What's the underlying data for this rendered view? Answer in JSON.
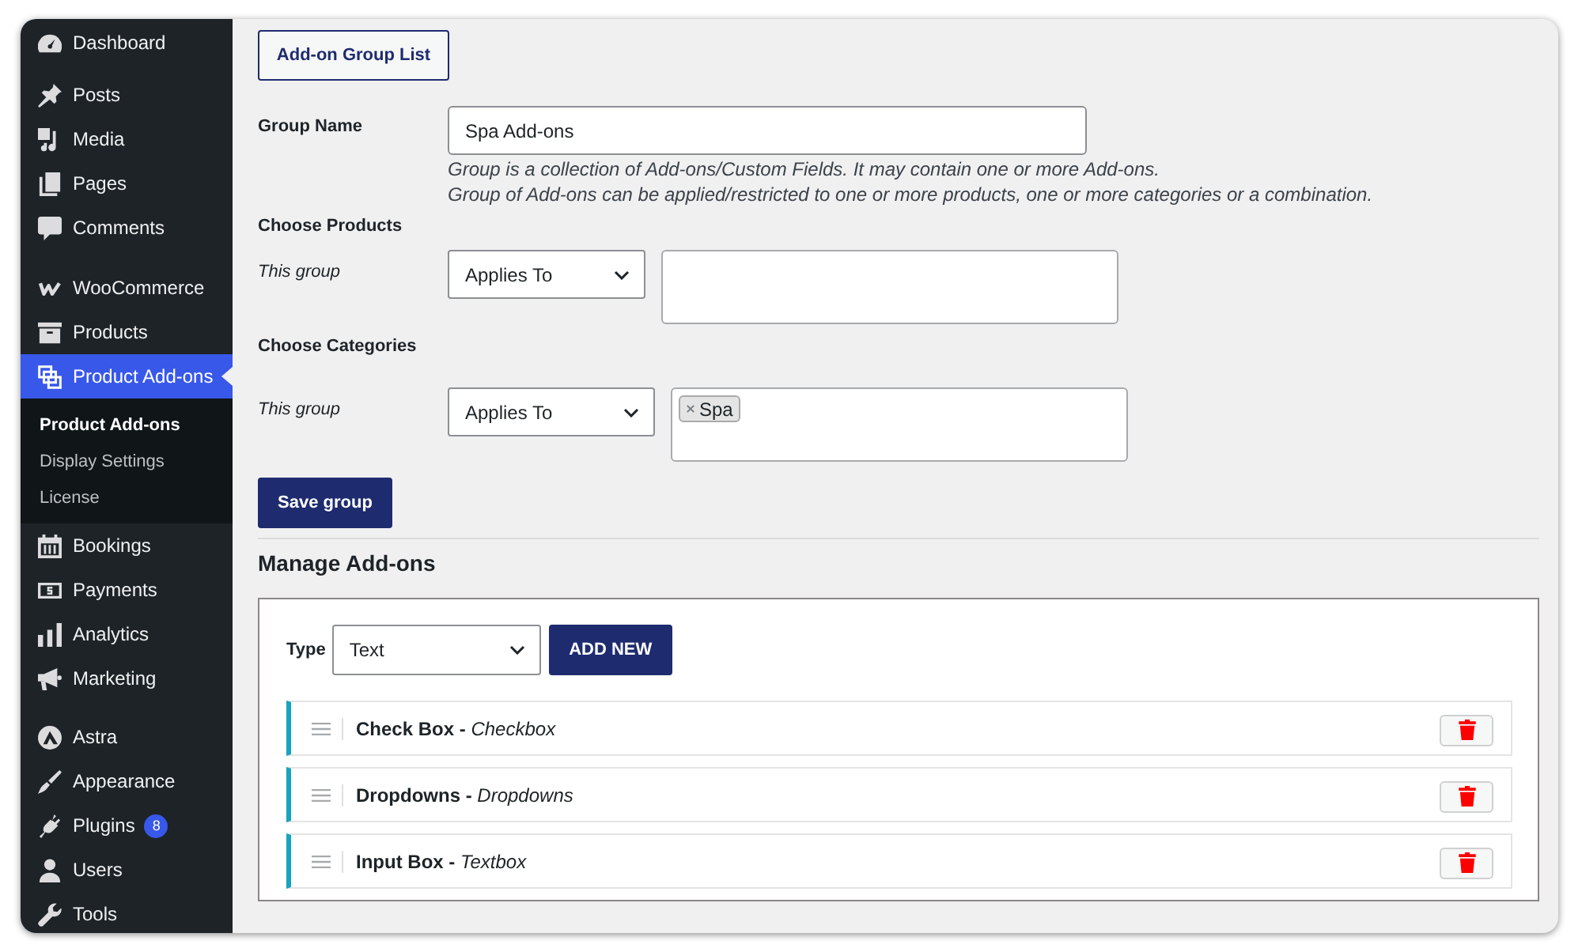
{
  "sidebar": {
    "groups": [
      {
        "items": [
          {
            "label": "Dashboard",
            "selected": false
          }
        ]
      },
      {
        "items": [
          {
            "label": "Posts",
            "selected": false
          },
          {
            "label": "Media",
            "selected": false
          },
          {
            "label": "Pages",
            "selected": false
          },
          {
            "label": "Comments",
            "selected": false
          }
        ]
      },
      {
        "items": [
          {
            "label": "WooCommerce",
            "selected": false
          },
          {
            "label": "Products",
            "selected": false
          },
          {
            "label": "Product Add-ons",
            "selected": true,
            "children": [
              {
                "label": "Product Add-ons",
                "selected": true
              },
              {
                "label": "Display Settings",
                "selected": false
              },
              {
                "label": "License",
                "selected": false
              }
            ]
          },
          {
            "label": "Bookings",
            "selected": false
          },
          {
            "label": "Payments",
            "selected": false
          },
          {
            "label": "Analytics",
            "selected": false
          },
          {
            "label": "Marketing",
            "selected": false
          }
        ]
      },
      {
        "items": [
          {
            "label": "Astra",
            "selected": false
          },
          {
            "label": "Appearance",
            "selected": false
          },
          {
            "label": "Plugins",
            "selected": false,
            "badge": "8"
          },
          {
            "label": "Users",
            "selected": false
          },
          {
            "label": "Tools",
            "selected": false
          }
        ]
      }
    ]
  },
  "group_list_button": "Add-on Group List",
  "group_form": {
    "name_field": {
      "label": "Group Name",
      "value": "Spa Add-ons"
    },
    "help": [
      "Group is a collection of Add-ons/Custom Fields. It may contain one or more Add-ons.",
      "Group of Add-ons can be applied/restricted to one or more products, one or more categories or a combination."
    ],
    "sections": [
      {
        "heading": "Choose Products",
        "label": "This group",
        "select": "Applies To"
      },
      {
        "heading": "Choose Categories",
        "label": "This group",
        "select": "Applies To",
        "tags": [
          {
            "label": "Spa"
          }
        ]
      }
    ],
    "save_button": "Save group"
  },
  "manage_addons": {
    "heading": "Manage Add-ons",
    "type_label": "Type",
    "type_select": "Text",
    "add_button": "ADD NEW",
    "addons": [
      {
        "title": "**Check Box -** *Checkbox*"
      },
      {
        "title": "**Dropdowns -** *Dropdowns*"
      },
      {
        "title": "**Input Box -** *Textbox*"
      }
    ]
  }
}
